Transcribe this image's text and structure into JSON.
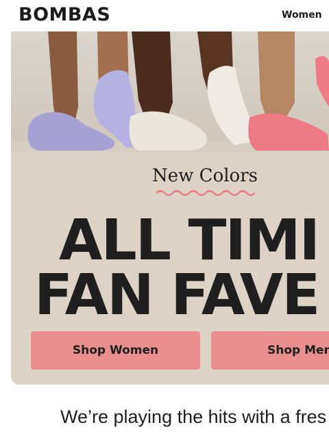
{
  "header": {
    "logo_text": "BOMBAS",
    "nav_women": "Women"
  },
  "hero": {
    "image": "socks-lineup-photo",
    "eyebrow": "New Colors",
    "headline_line1": "ALL TIMI",
    "headline_line2": "FAN FAVE",
    "buttons": [
      {
        "label": "Shop Women"
      },
      {
        "label": "Shop Men"
      }
    ],
    "colors": {
      "panel": "#dcd3c6",
      "button": "#e98f8f",
      "squiggle": "#e97f86"
    }
  },
  "body": {
    "tagline": "We’re playing the hits with a fres"
  }
}
